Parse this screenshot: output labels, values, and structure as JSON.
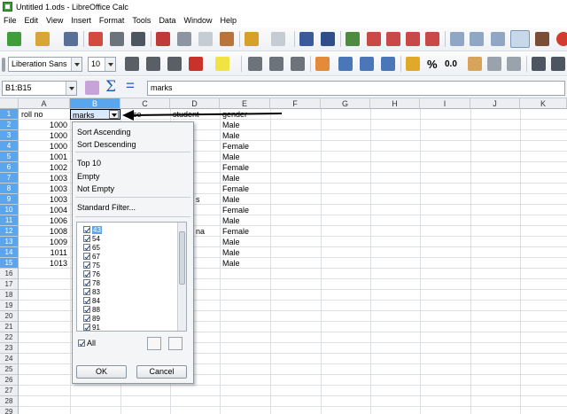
{
  "window": {
    "title": "Untitled 1.ods - LibreOffice Calc"
  },
  "menu": [
    "File",
    "Edit",
    "View",
    "Insert",
    "Format",
    "Tools",
    "Data",
    "Window",
    "Help"
  ],
  "toolbar": {
    "font_name": "Liberation Sans",
    "font_size": "10",
    "percent_label": "%",
    "number_label": "0.0"
  },
  "formula_bar": {
    "name_box": "B1:B15",
    "content": "marks"
  },
  "columns": [
    "A",
    "B",
    "C",
    "D",
    "E",
    "F",
    "G",
    "H",
    "I",
    "J",
    "K"
  ],
  "rows": [
    "1",
    "2",
    "3",
    "4",
    "5",
    "6",
    "7",
    "8",
    "9",
    "10",
    "11",
    "12",
    "13",
    "14",
    "15",
    "16",
    "17",
    "18",
    "19",
    "20",
    "21",
    "22",
    "23",
    "24",
    "25",
    "26",
    "27",
    "28",
    "29"
  ],
  "sheet": {
    "a1": "roll no",
    "b1": "marks",
    "c1": "ce",
    "d1": "student",
    "e1": "gender",
    "col_a": [
      "1000",
      "1000",
      "1000",
      "1001",
      "1002",
      "1003",
      "1003",
      "1003",
      "1004",
      "1006",
      "1008",
      "1009",
      "1011",
      "1013"
    ],
    "col_e": [
      "Male",
      "Male",
      "Female",
      "Male",
      "Female",
      "Male",
      "Female",
      "Male",
      "Female",
      "Male",
      "Female",
      "Male",
      "Male",
      "Male"
    ],
    "d_fragments": {
      "row9": "s",
      "row12": "na"
    }
  },
  "autofilter": {
    "sort_ascending": "Sort Ascending",
    "sort_descending": "Sort Descending",
    "top10": "Top 10",
    "empty": "Empty",
    "not_empty": "Not Empty",
    "standard_filter": "Standard Filter...",
    "values": [
      "43",
      "54",
      "65",
      "67",
      "75",
      "76",
      "78",
      "83",
      "84",
      "88",
      "89",
      "91"
    ],
    "all_label": "All",
    "ok_label": "OK",
    "cancel_label": "Cancel"
  }
}
